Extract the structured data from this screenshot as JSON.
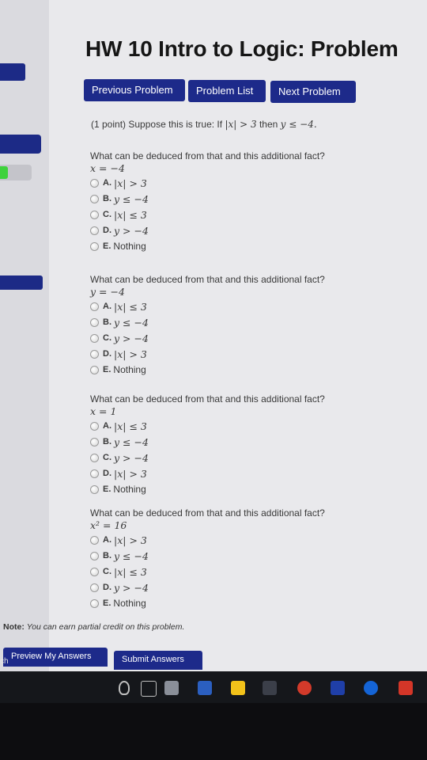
{
  "page": {
    "title": "HW 10 Intro to Logic: Problem"
  },
  "nav": {
    "previous": "Previous Problem",
    "list": "Problem List",
    "next": "Next Problem"
  },
  "intro": {
    "points": "(1 point)",
    "text": "Suppose this is true: If",
    "math1": "|x| > 3",
    "then": "then",
    "math2": "y ≤ −4."
  },
  "questions": [
    {
      "prompt": "What can be deduced from that and this additional fact?",
      "fact": "x = −4",
      "options": [
        {
          "letter": "A.",
          "text": "|x| > 3",
          "math": true
        },
        {
          "letter": "B.",
          "text": "y ≤ −4",
          "math": true
        },
        {
          "letter": "C.",
          "text": "|x| ≤ 3",
          "math": true
        },
        {
          "letter": "D.",
          "text": "y > −4",
          "math": true
        },
        {
          "letter": "E.",
          "text": "Nothing",
          "math": false
        }
      ]
    },
    {
      "prompt": "What can be deduced from that and this additional fact?",
      "fact": "y = −4",
      "options": [
        {
          "letter": "A.",
          "text": "|x| ≤ 3",
          "math": true
        },
        {
          "letter": "B.",
          "text": "y ≤ −4",
          "math": true
        },
        {
          "letter": "C.",
          "text": "y > −4",
          "math": true
        },
        {
          "letter": "D.",
          "text": "|x| > 3",
          "math": true
        },
        {
          "letter": "E.",
          "text": "Nothing",
          "math": false
        }
      ]
    },
    {
      "prompt": "What can be deduced from that and this additional fact?",
      "fact": "x = 1",
      "options": [
        {
          "letter": "A.",
          "text": "|x| ≤ 3",
          "math": true
        },
        {
          "letter": "B.",
          "text": "y ≤ −4",
          "math": true
        },
        {
          "letter": "C.",
          "text": "y > −4",
          "math": true
        },
        {
          "letter": "D.",
          "text": "|x| > 3",
          "math": true
        },
        {
          "letter": "E.",
          "text": "Nothing",
          "math": false
        }
      ]
    },
    {
      "prompt": "What can be deduced from that and this additional fact?",
      "fact": "x² = 16",
      "options": [
        {
          "letter": "A.",
          "text": "|x| > 3",
          "math": true
        },
        {
          "letter": "B.",
          "text": "y ≤ −4",
          "math": true
        },
        {
          "letter": "C.",
          "text": "|x| ≤ 3",
          "math": true
        },
        {
          "letter": "D.",
          "text": "y > −4",
          "math": true
        },
        {
          "letter": "E.",
          "text": "Nothing",
          "math": false
        }
      ]
    }
  ],
  "note": {
    "label": "Note:",
    "text": "You can earn partial credit on this problem."
  },
  "actions": {
    "preview": "Preview My Answers",
    "submit": "Submit Answers"
  },
  "taskbar": {
    "search_fragment": "ch"
  },
  "colors": {
    "accent": "#1d2a8a",
    "page_bg": "#e9e9ec",
    "toggle_on": "#3fd23c"
  }
}
